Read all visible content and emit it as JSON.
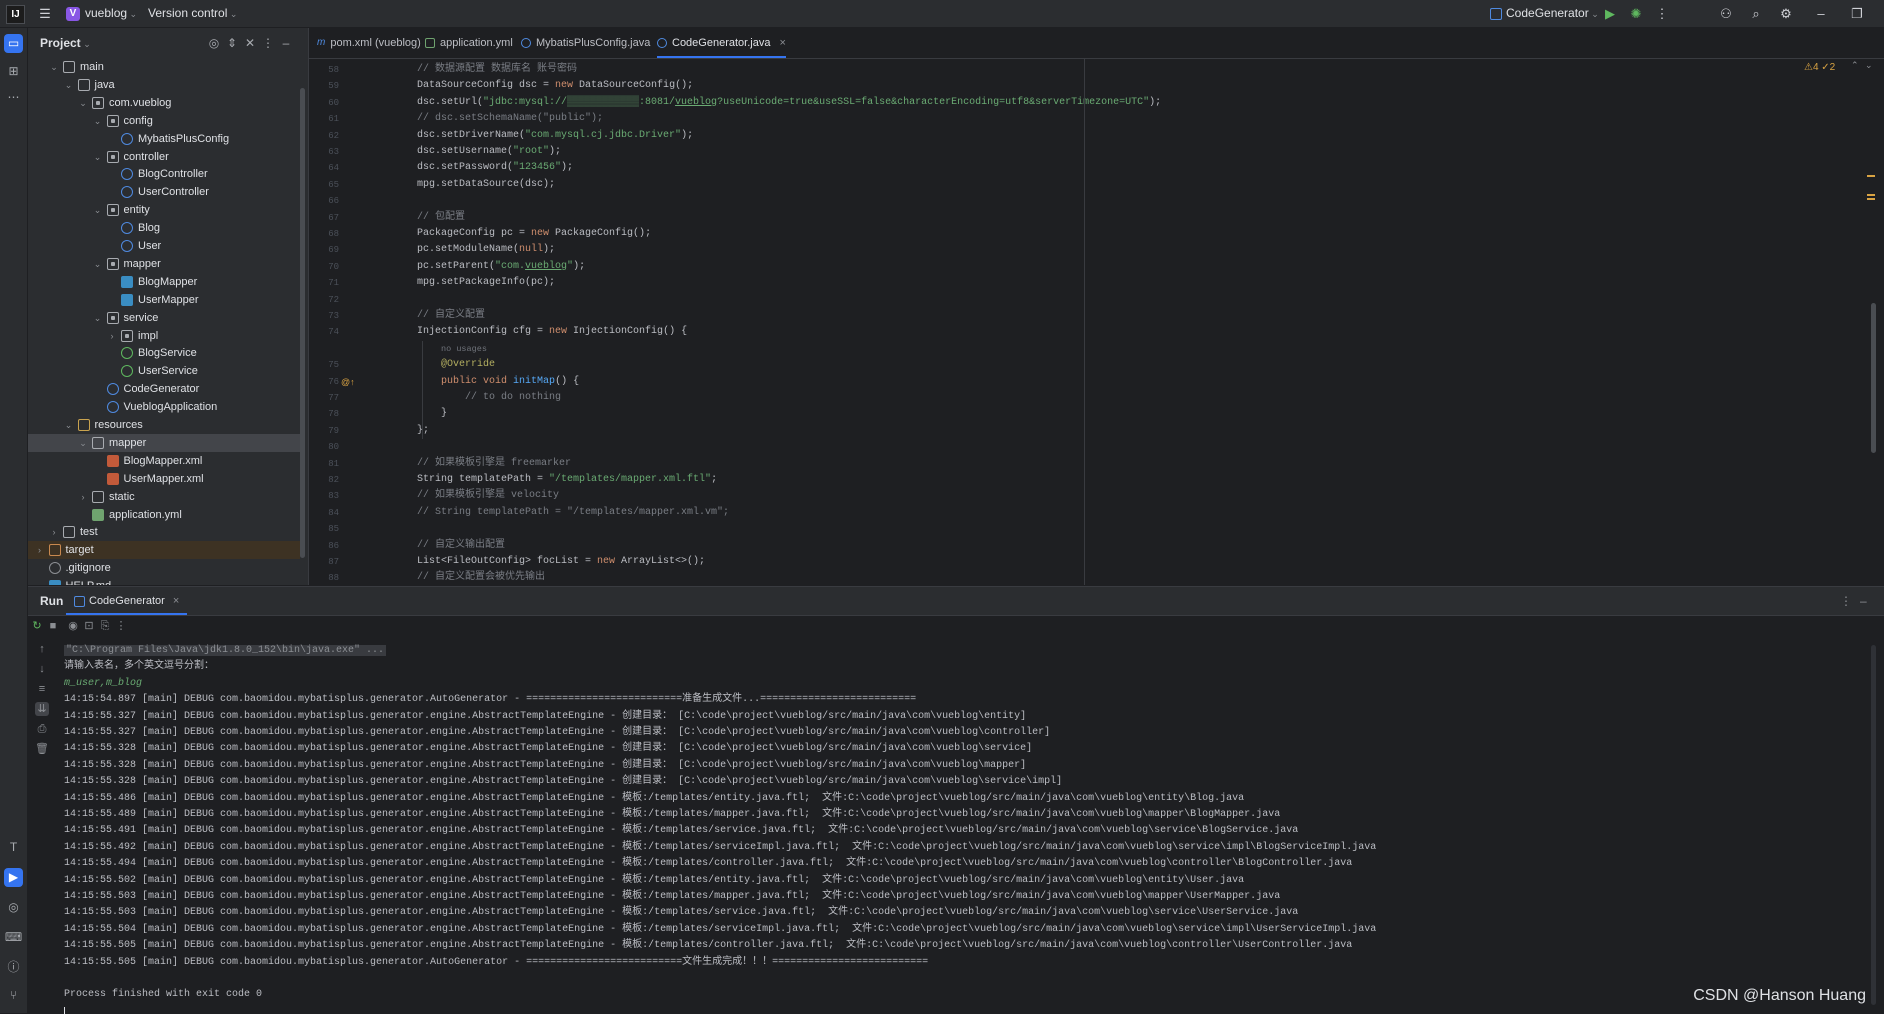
{
  "titlebar": {
    "logo": "IJ",
    "project_badge": "V",
    "project_name": "vueblog",
    "vcs": "Version control",
    "run_config": "CodeGenerator"
  },
  "project": {
    "title": "Project",
    "tree": [
      {
        "label": "main",
        "indent": 2,
        "arrow": "open",
        "icon": "folder"
      },
      {
        "label": "java",
        "indent": 3,
        "arrow": "open",
        "icon": "folder"
      },
      {
        "label": "com.vueblog",
        "indent": 4,
        "arrow": "open",
        "icon": "pkg"
      },
      {
        "label": "config",
        "indent": 5,
        "arrow": "open",
        "icon": "pkg"
      },
      {
        "label": "MybatisPlusConfig",
        "indent": 6,
        "arrow": "",
        "icon": "class"
      },
      {
        "label": "controller",
        "indent": 5,
        "arrow": "open",
        "icon": "pkg"
      },
      {
        "label": "BlogController",
        "indent": 6,
        "arrow": "",
        "icon": "class"
      },
      {
        "label": "UserController",
        "indent": 6,
        "arrow": "",
        "icon": "class"
      },
      {
        "label": "entity",
        "indent": 5,
        "arrow": "open",
        "icon": "pkg"
      },
      {
        "label": "Blog",
        "indent": 6,
        "arrow": "",
        "icon": "class"
      },
      {
        "label": "User",
        "indent": 6,
        "arrow": "",
        "icon": "class"
      },
      {
        "label": "mapper",
        "indent": 5,
        "arrow": "open",
        "icon": "pkg"
      },
      {
        "label": "BlogMapper",
        "indent": 6,
        "arrow": "",
        "icon": "mapper"
      },
      {
        "label": "UserMapper",
        "indent": 6,
        "arrow": "",
        "icon": "mapper"
      },
      {
        "label": "service",
        "indent": 5,
        "arrow": "open",
        "icon": "pkg"
      },
      {
        "label": "impl",
        "indent": 6,
        "arrow": "closed",
        "icon": "pkg"
      },
      {
        "label": "BlogService",
        "indent": 6,
        "arrow": "",
        "icon": "interface"
      },
      {
        "label": "UserService",
        "indent": 6,
        "arrow": "",
        "icon": "interface"
      },
      {
        "label": "CodeGenerator",
        "indent": 5,
        "arrow": "",
        "icon": "class"
      },
      {
        "label": "VueblogApplication",
        "indent": 5,
        "arrow": "",
        "icon": "class"
      },
      {
        "label": "resources",
        "indent": 3,
        "arrow": "open",
        "icon": "res"
      },
      {
        "label": "mapper",
        "indent": 4,
        "arrow": "open",
        "icon": "folder",
        "selected": true
      },
      {
        "label": "BlogMapper.xml",
        "indent": 5,
        "arrow": "",
        "icon": "xml"
      },
      {
        "label": "UserMapper.xml",
        "indent": 5,
        "arrow": "",
        "icon": "xml"
      },
      {
        "label": "static",
        "indent": 4,
        "arrow": "closed",
        "icon": "folder"
      },
      {
        "label": "application.yml",
        "indent": 4,
        "arrow": "",
        "icon": "yml"
      },
      {
        "label": "test",
        "indent": 2,
        "arrow": "closed",
        "icon": "folder"
      },
      {
        "label": "target",
        "indent": 1,
        "arrow": "closed",
        "icon": "tgt",
        "target": true
      },
      {
        "label": ".gitignore",
        "indent": 1,
        "arrow": "",
        "icon": "git"
      },
      {
        "label": "HELP.md",
        "indent": 1,
        "arrow": "",
        "icon": "md"
      }
    ]
  },
  "editor": {
    "tabs": [
      {
        "label": "pom.xml (vueblog)",
        "icon": "m"
      },
      {
        "label": "application.yml",
        "icon": "y"
      },
      {
        "label": "MybatisPlusConfig.java",
        "icon": "c"
      },
      {
        "label": "CodeGenerator.java",
        "icon": "c",
        "active": true
      }
    ],
    "inspections": "⚠4 ✓2",
    "lines": [
      {
        "n": "58",
        "html": "<span class='cmt'>// 数据源配置 数据库名 账号密码</span>"
      },
      {
        "n": "59",
        "html": "DataSourceConfig dsc = <span class='kw'>new</span> DataSourceConfig();"
      },
      {
        "n": "60",
        "html": "dsc.setUrl(<span class='str'>\"jdbc:mysql://▒▒▒▒▒▒▒▒▒▒▒▒:8081/<u>vueblog</u>?useUnicode=true&useSSL=false&characterEncoding=utf8&serverTimezone=UTC\"</span>);"
      },
      {
        "n": "61",
        "html": "<span class='cmt'>// dsc.setSchemaName(\"public\");</span>"
      },
      {
        "n": "62",
        "html": "dsc.setDriverName(<span class='str'>\"com.mysql.cj.jdbc.Driver\"</span>);"
      },
      {
        "n": "63",
        "html": "dsc.setUsername(<span class='str'>\"root\"</span>);"
      },
      {
        "n": "64",
        "html": "dsc.setPassword(<span class='str'>\"123456\"</span>);"
      },
      {
        "n": "65",
        "html": "mpg.setDataSource(dsc);"
      },
      {
        "n": "66",
        "html": ""
      },
      {
        "n": "67",
        "html": "<span class='cmt'>// 包配置</span>"
      },
      {
        "n": "68",
        "html": "PackageConfig pc = <span class='kw'>new</span> PackageConfig();"
      },
      {
        "n": "69",
        "html": "pc.setModuleName(<span class='kw'>null</span>);"
      },
      {
        "n": "70",
        "html": "pc.setParent(<span class='str'>\"com.<u>vueblog</u>\"</span>);"
      },
      {
        "n": "71",
        "html": "mpg.setPackageInfo(pc);"
      },
      {
        "n": "72",
        "html": ""
      },
      {
        "n": "73",
        "html": "<span class='cmt'>// 自定义配置</span>"
      },
      {
        "n": "74",
        "html": "InjectionConfig cfg = <span class='kw'>new</span> InjectionConfig() {"
      },
      {
        "n": "",
        "html": "    <span class='hint'>no usages</span>"
      },
      {
        "n": "75",
        "html": "    <span class='ann'>@Override</span>"
      },
      {
        "n": "76",
        "html": "    <span class='kw'>public void</span> <span class='fn'>initMap</span>() {"
      },
      {
        "n": "77",
        "html": "        <span class='cmt'>// to do nothing</span>"
      },
      {
        "n": "78",
        "html": "    }"
      },
      {
        "n": "79",
        "html": "};"
      },
      {
        "n": "80",
        "html": ""
      },
      {
        "n": "81",
        "html": "<span class='cmt'>// 如果模板引擎是 freemarker</span>"
      },
      {
        "n": "82",
        "html": "String templatePath = <span class='str'>\"/templates/mapper.xml.ftl\"</span>;"
      },
      {
        "n": "83",
        "html": "<span class='cmt'>// 如果模板引擎是 velocity</span>"
      },
      {
        "n": "84",
        "html": "<span class='cmt'>// String templatePath = \"/templates/mapper.xml.vm\";</span>"
      },
      {
        "n": "85",
        "html": ""
      },
      {
        "n": "86",
        "html": "<span class='cmt'>// 自定义输出配置</span>"
      },
      {
        "n": "87",
        "html": "List&lt;FileOutConfig&gt; focList = <span class='kw'>new</span> ArrayList&lt;&gt;();"
      },
      {
        "n": "88",
        "html": "<span class='cmt'>// 自定义配置会被优先输出</span>"
      }
    ]
  },
  "run": {
    "tab_run": "Run",
    "tab_config": "CodeGenerator",
    "console": [
      {
        "text": "\"C:\\Program Files\\Java\\jdk1.8.0_152\\bin\\java.exe\" ...",
        "cls": "cmdline"
      },
      {
        "text": "请输入表名，多个英文逗号分割：",
        "cls": ""
      },
      {
        "text": "m_user,m_blog",
        "cls": "userin"
      },
      {
        "text": "14:15:54.897 [main] DEBUG com.baomidou.mybatisplus.generator.AutoGenerator - ==========================准备生成文件...==========================",
        "cls": ""
      },
      {
        "text": "14:15:55.327 [main] DEBUG com.baomidou.mybatisplus.generator.engine.AbstractTemplateEngine - 创建目录： [C:\\code\\project\\vueblog/src/main/java\\com\\vueblog\\entity]",
        "cls": ""
      },
      {
        "text": "14:15:55.327 [main] DEBUG com.baomidou.mybatisplus.generator.engine.AbstractTemplateEngine - 创建目录： [C:\\code\\project\\vueblog/src/main/java\\com\\vueblog\\controller]",
        "cls": ""
      },
      {
        "text": "14:15:55.328 [main] DEBUG com.baomidou.mybatisplus.generator.engine.AbstractTemplateEngine - 创建目录： [C:\\code\\project\\vueblog/src/main/java\\com\\vueblog\\service]",
        "cls": ""
      },
      {
        "text": "14:15:55.328 [main] DEBUG com.baomidou.mybatisplus.generator.engine.AbstractTemplateEngine - 创建目录： [C:\\code\\project\\vueblog/src/main/java\\com\\vueblog\\mapper]",
        "cls": ""
      },
      {
        "text": "14:15:55.328 [main] DEBUG com.baomidou.mybatisplus.generator.engine.AbstractTemplateEngine - 创建目录： [C:\\code\\project\\vueblog/src/main/java\\com\\vueblog\\service\\impl]",
        "cls": ""
      },
      {
        "text": "14:15:55.486 [main] DEBUG com.baomidou.mybatisplus.generator.engine.AbstractTemplateEngine - 模板:/templates/entity.java.ftl;  文件:C:\\code\\project\\vueblog/src/main/java\\com\\vueblog\\entity\\Blog.java",
        "cls": ""
      },
      {
        "text": "14:15:55.489 [main] DEBUG com.baomidou.mybatisplus.generator.engine.AbstractTemplateEngine - 模板:/templates/mapper.java.ftl;  文件:C:\\code\\project\\vueblog/src/main/java\\com\\vueblog\\mapper\\BlogMapper.java",
        "cls": ""
      },
      {
        "text": "14:15:55.491 [main] DEBUG com.baomidou.mybatisplus.generator.engine.AbstractTemplateEngine - 模板:/templates/service.java.ftl;  文件:C:\\code\\project\\vueblog/src/main/java\\com\\vueblog\\service\\BlogService.java",
        "cls": ""
      },
      {
        "text": "14:15:55.492 [main] DEBUG com.baomidou.mybatisplus.generator.engine.AbstractTemplateEngine - 模板:/templates/serviceImpl.java.ftl;  文件:C:\\code\\project\\vueblog/src/main/java\\com\\vueblog\\service\\impl\\BlogServiceImpl.java",
        "cls": ""
      },
      {
        "text": "14:15:55.494 [main] DEBUG com.baomidou.mybatisplus.generator.engine.AbstractTemplateEngine - 模板:/templates/controller.java.ftl;  文件:C:\\code\\project\\vueblog/src/main/java\\com\\vueblog\\controller\\BlogController.java",
        "cls": ""
      },
      {
        "text": "14:15:55.502 [main] DEBUG com.baomidou.mybatisplus.generator.engine.AbstractTemplateEngine - 模板:/templates/entity.java.ftl;  文件:C:\\code\\project\\vueblog/src/main/java\\com\\vueblog\\entity\\User.java",
        "cls": ""
      },
      {
        "text": "14:15:55.503 [main] DEBUG com.baomidou.mybatisplus.generator.engine.AbstractTemplateEngine - 模板:/templates/mapper.java.ftl;  文件:C:\\code\\project\\vueblog/src/main/java\\com\\vueblog\\mapper\\UserMapper.java",
        "cls": ""
      },
      {
        "text": "14:15:55.503 [main] DEBUG com.baomidou.mybatisplus.generator.engine.AbstractTemplateEngine - 模板:/templates/service.java.ftl;  文件:C:\\code\\project\\vueblog/src/main/java\\com\\vueblog\\service\\UserService.java",
        "cls": ""
      },
      {
        "text": "14:15:55.504 [main] DEBUG com.baomidou.mybatisplus.generator.engine.AbstractTemplateEngine - 模板:/templates/serviceImpl.java.ftl;  文件:C:\\code\\project\\vueblog/src/main/java\\com\\vueblog\\service\\impl\\UserServiceImpl.java",
        "cls": ""
      },
      {
        "text": "14:15:55.505 [main] DEBUG com.baomidou.mybatisplus.generator.engine.AbstractTemplateEngine - 模板:/templates/controller.java.ftl;  文件:C:\\code\\project\\vueblog/src/main/java\\com\\vueblog\\controller\\UserController.java",
        "cls": ""
      },
      {
        "text": "14:15:55.505 [main] DEBUG com.baomidou.mybatisplus.generator.AutoGenerator - ==========================文件生成完成！！！==========================",
        "cls": ""
      },
      {
        "text": "",
        "cls": ""
      },
      {
        "text": "Process finished with exit code 0",
        "cls": ""
      }
    ]
  },
  "watermark": "CSDN @Hanson Huang",
  "colors": {
    "accent": "#3574f0",
    "bg": "#1e1f22",
    "panel": "#2b2d30"
  }
}
